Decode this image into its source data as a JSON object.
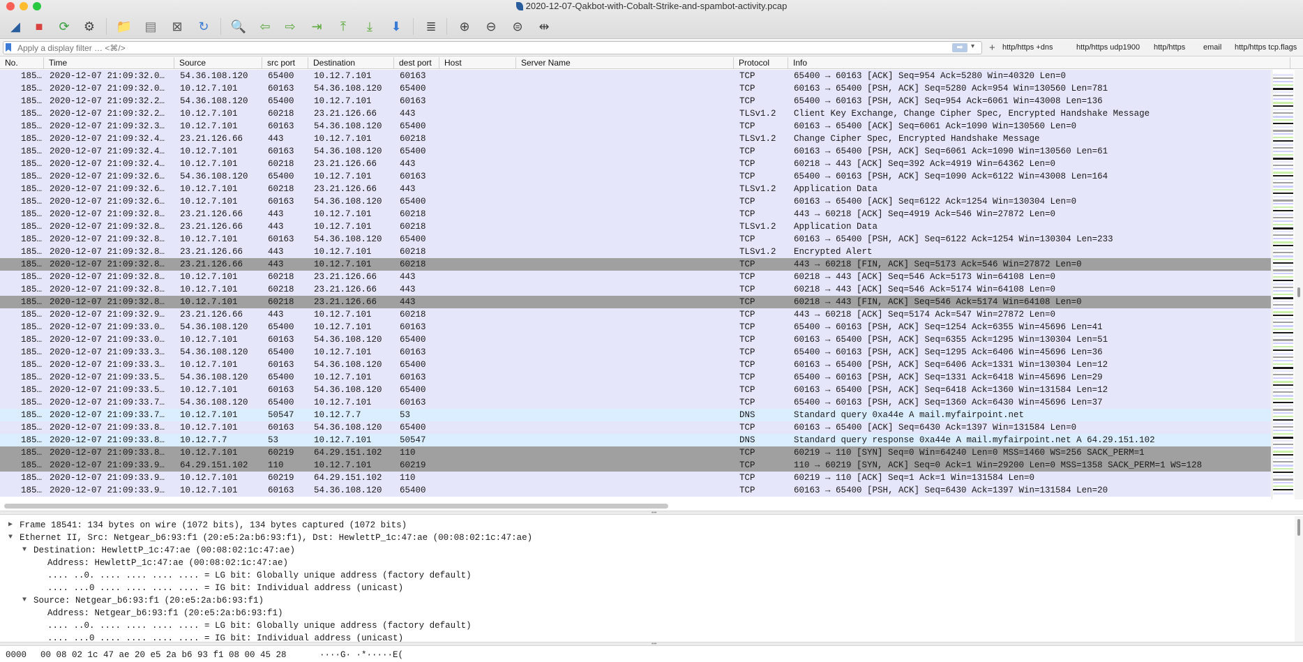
{
  "window": {
    "title": "2020-12-07-Qakbot-with-Cobalt-Strike-and-spambot-activity.pcap",
    "traffic_colors": [
      "#fe5f57",
      "#febc2e",
      "#28c840"
    ]
  },
  "toolbar": [
    {
      "name": "start-capture-icon",
      "glyph": "◢",
      "color": "#2a5d9e"
    },
    {
      "name": "stop-capture-icon",
      "glyph": "■",
      "color": "#d94040"
    },
    {
      "name": "restart-capture-icon",
      "glyph": "⟳",
      "color": "#3aa040"
    },
    {
      "name": "capture-options-icon",
      "glyph": "⚙",
      "color": "#444444"
    },
    {
      "name": "open-file-icon",
      "glyph": "📁",
      "color": "#3a7bd5"
    },
    {
      "name": "save-file-icon",
      "glyph": "▤",
      "color": "#777777"
    },
    {
      "name": "close-file-icon",
      "glyph": "⊠",
      "color": "#555555"
    },
    {
      "name": "reload-file-icon",
      "glyph": "↻",
      "color": "#3a7bd5"
    },
    {
      "name": "find-packet-icon",
      "glyph": "🔍",
      "color": "#444444"
    },
    {
      "name": "go-back-icon",
      "glyph": "⇦",
      "color": "#5aa83a"
    },
    {
      "name": "go-forward-icon",
      "glyph": "⇨",
      "color": "#5aa83a"
    },
    {
      "name": "go-to-packet-icon",
      "glyph": "⇥",
      "color": "#5aa83a"
    },
    {
      "name": "first-packet-icon",
      "glyph": "⤒",
      "color": "#5aa83a"
    },
    {
      "name": "last-packet-icon",
      "glyph": "⤓",
      "color": "#5aa83a"
    },
    {
      "name": "auto-scroll-icon",
      "glyph": "⬇",
      "color": "#3a7bd5"
    },
    {
      "name": "colorize-icon",
      "glyph": "≣",
      "color": "#444444"
    },
    {
      "name": "zoom-in-icon",
      "glyph": "⊕",
      "color": "#444444"
    },
    {
      "name": "zoom-out-icon",
      "glyph": "⊖",
      "color": "#444444"
    },
    {
      "name": "zoom-reset-icon",
      "glyph": "⊜",
      "color": "#444444"
    },
    {
      "name": "resize-columns-icon",
      "glyph": "⇹",
      "color": "#444444"
    }
  ],
  "filter": {
    "placeholder": "Apply a display filter … <⌘/>",
    "buttons": [
      "http/https +dns",
      "http/https udp1900",
      "http/https",
      "email",
      "http/https tcp.flags"
    ]
  },
  "columns": [
    "No.",
    "Time",
    "Source",
    "src port",
    "Destination",
    "dest port",
    "Host",
    "Server Name",
    "Protocol",
    "Info"
  ],
  "packets": [
    {
      "no": "185…",
      "time": "2020-12-07 21:09:32.0…",
      "src": "54.36.108.120",
      "sport": "65400",
      "dst": "10.12.7.101",
      "dport": "60163",
      "host": "",
      "server": "",
      "proto": "TCP",
      "info": "65400 → 60163 [ACK] Seq=954 Ack=5280 Win=40320 Len=0",
      "style": "tcp"
    },
    {
      "no": "185…",
      "time": "2020-12-07 21:09:32.0…",
      "src": "10.12.7.101",
      "sport": "60163",
      "dst": "54.36.108.120",
      "dport": "65400",
      "host": "",
      "server": "",
      "proto": "TCP",
      "info": "60163 → 65400 [PSH, ACK] Seq=5280 Ack=954 Win=130560 Len=781",
      "style": "tcp"
    },
    {
      "no": "185…",
      "time": "2020-12-07 21:09:32.2…",
      "src": "54.36.108.120",
      "sport": "65400",
      "dst": "10.12.7.101",
      "dport": "60163",
      "host": "",
      "server": "",
      "proto": "TCP",
      "info": "65400 → 60163 [PSH, ACK] Seq=954 Ack=6061 Win=43008 Len=136",
      "style": "tcp"
    },
    {
      "no": "185…",
      "time": "2020-12-07 21:09:32.2…",
      "src": "10.12.7.101",
      "sport": "60218",
      "dst": "23.21.126.66",
      "dport": "443",
      "host": "",
      "server": "",
      "proto": "TLSv1.2",
      "info": "Client Key Exchange, Change Cipher Spec, Encrypted Handshake Message",
      "style": "tcp"
    },
    {
      "no": "185…",
      "time": "2020-12-07 21:09:32.3…",
      "src": "10.12.7.101",
      "sport": "60163",
      "dst": "54.36.108.120",
      "dport": "65400",
      "host": "",
      "server": "",
      "proto": "TCP",
      "info": "60163 → 65400 [ACK] Seq=6061 Ack=1090 Win=130560 Len=0",
      "style": "tcp"
    },
    {
      "no": "185…",
      "time": "2020-12-07 21:09:32.4…",
      "src": "23.21.126.66",
      "sport": "443",
      "dst": "10.12.7.101",
      "dport": "60218",
      "host": "",
      "server": "",
      "proto": "TLSv1.2",
      "info": "Change Cipher Spec, Encrypted Handshake Message",
      "style": "tcp"
    },
    {
      "no": "185…",
      "time": "2020-12-07 21:09:32.4…",
      "src": "10.12.7.101",
      "sport": "60163",
      "dst": "54.36.108.120",
      "dport": "65400",
      "host": "",
      "server": "",
      "proto": "TCP",
      "info": "60163 → 65400 [PSH, ACK] Seq=6061 Ack=1090 Win=130560 Len=61",
      "style": "tcp"
    },
    {
      "no": "185…",
      "time": "2020-12-07 21:09:32.4…",
      "src": "10.12.7.101",
      "sport": "60218",
      "dst": "23.21.126.66",
      "dport": "443",
      "host": "",
      "server": "",
      "proto": "TCP",
      "info": "60218 → 443 [ACK] Seq=392 Ack=4919 Win=64362 Len=0",
      "style": "tcp"
    },
    {
      "no": "185…",
      "time": "2020-12-07 21:09:32.6…",
      "src": "54.36.108.120",
      "sport": "65400",
      "dst": "10.12.7.101",
      "dport": "60163",
      "host": "",
      "server": "",
      "proto": "TCP",
      "info": "65400 → 60163 [PSH, ACK] Seq=1090 Ack=6122 Win=43008 Len=164",
      "style": "tcp"
    },
    {
      "no": "185…",
      "time": "2020-12-07 21:09:32.6…",
      "src": "10.12.7.101",
      "sport": "60218",
      "dst": "23.21.126.66",
      "dport": "443",
      "host": "",
      "server": "",
      "proto": "TLSv1.2",
      "info": "Application Data",
      "style": "tcp"
    },
    {
      "no": "185…",
      "time": "2020-12-07 21:09:32.6…",
      "src": "10.12.7.101",
      "sport": "60163",
      "dst": "54.36.108.120",
      "dport": "65400",
      "host": "",
      "server": "",
      "proto": "TCP",
      "info": "60163 → 65400 [ACK] Seq=6122 Ack=1254 Win=130304 Len=0",
      "style": "tcp"
    },
    {
      "no": "185…",
      "time": "2020-12-07 21:09:32.8…",
      "src": "23.21.126.66",
      "sport": "443",
      "dst": "10.12.7.101",
      "dport": "60218",
      "host": "",
      "server": "",
      "proto": "TCP",
      "info": "443 → 60218 [ACK] Seq=4919 Ack=546 Win=27872 Len=0",
      "style": "tcp"
    },
    {
      "no": "185…",
      "time": "2020-12-07 21:09:32.8…",
      "src": "23.21.126.66",
      "sport": "443",
      "dst": "10.12.7.101",
      "dport": "60218",
      "host": "",
      "server": "",
      "proto": "TLSv1.2",
      "info": "Application Data",
      "style": "tcp"
    },
    {
      "no": "185…",
      "time": "2020-12-07 21:09:32.8…",
      "src": "10.12.7.101",
      "sport": "60163",
      "dst": "54.36.108.120",
      "dport": "65400",
      "host": "",
      "server": "",
      "proto": "TCP",
      "info": "60163 → 65400 [PSH, ACK] Seq=6122 Ack=1254 Win=130304 Len=233",
      "style": "tcp"
    },
    {
      "no": "185…",
      "time": "2020-12-07 21:09:32.8…",
      "src": "23.21.126.66",
      "sport": "443",
      "dst": "10.12.7.101",
      "dport": "60218",
      "host": "",
      "server": "",
      "proto": "TLSv1.2",
      "info": "Encrypted Alert",
      "style": "tcp"
    },
    {
      "no": "185…",
      "time": "2020-12-07 21:09:32.8…",
      "src": "23.21.126.66",
      "sport": "443",
      "dst": "10.12.7.101",
      "dport": "60218",
      "host": "",
      "server": "",
      "proto": "TCP",
      "info": "443 → 60218 [FIN, ACK] Seq=5173 Ack=546 Win=27872 Len=0",
      "style": "gray"
    },
    {
      "no": "185…",
      "time": "2020-12-07 21:09:32.8…",
      "src": "10.12.7.101",
      "sport": "60218",
      "dst": "23.21.126.66",
      "dport": "443",
      "host": "",
      "server": "",
      "proto": "TCP",
      "info": "60218 → 443 [ACK] Seq=546 Ack=5173 Win=64108 Len=0",
      "style": "tcp"
    },
    {
      "no": "185…",
      "time": "2020-12-07 21:09:32.8…",
      "src": "10.12.7.101",
      "sport": "60218",
      "dst": "23.21.126.66",
      "dport": "443",
      "host": "",
      "server": "",
      "proto": "TCP",
      "info": "60218 → 443 [ACK] Seq=546 Ack=5174 Win=64108 Len=0",
      "style": "tcp"
    },
    {
      "no": "185…",
      "time": "2020-12-07 21:09:32.8…",
      "src": "10.12.7.101",
      "sport": "60218",
      "dst": "23.21.126.66",
      "dport": "443",
      "host": "",
      "server": "",
      "proto": "TCP",
      "info": "60218 → 443 [FIN, ACK] Seq=546 Ack=5174 Win=64108 Len=0",
      "style": "gray"
    },
    {
      "no": "185…",
      "time": "2020-12-07 21:09:32.9…",
      "src": "23.21.126.66",
      "sport": "443",
      "dst": "10.12.7.101",
      "dport": "60218",
      "host": "",
      "server": "",
      "proto": "TCP",
      "info": "443 → 60218 [ACK] Seq=5174 Ack=547 Win=27872 Len=0",
      "style": "tcp"
    },
    {
      "no": "185…",
      "time": "2020-12-07 21:09:33.0…",
      "src": "54.36.108.120",
      "sport": "65400",
      "dst": "10.12.7.101",
      "dport": "60163",
      "host": "",
      "server": "",
      "proto": "TCP",
      "info": "65400 → 60163 [PSH, ACK] Seq=1254 Ack=6355 Win=45696 Len=41",
      "style": "tcp"
    },
    {
      "no": "185…",
      "time": "2020-12-07 21:09:33.0…",
      "src": "10.12.7.101",
      "sport": "60163",
      "dst": "54.36.108.120",
      "dport": "65400",
      "host": "",
      "server": "",
      "proto": "TCP",
      "info": "60163 → 65400 [PSH, ACK] Seq=6355 Ack=1295 Win=130304 Len=51",
      "style": "tcp"
    },
    {
      "no": "185…",
      "time": "2020-12-07 21:09:33.3…",
      "src": "54.36.108.120",
      "sport": "65400",
      "dst": "10.12.7.101",
      "dport": "60163",
      "host": "",
      "server": "",
      "proto": "TCP",
      "info": "65400 → 60163 [PSH, ACK] Seq=1295 Ack=6406 Win=45696 Len=36",
      "style": "tcp"
    },
    {
      "no": "185…",
      "time": "2020-12-07 21:09:33.3…",
      "src": "10.12.7.101",
      "sport": "60163",
      "dst": "54.36.108.120",
      "dport": "65400",
      "host": "",
      "server": "",
      "proto": "TCP",
      "info": "60163 → 65400 [PSH, ACK] Seq=6406 Ack=1331 Win=130304 Len=12",
      "style": "tcp"
    },
    {
      "no": "185…",
      "time": "2020-12-07 21:09:33.5…",
      "src": "54.36.108.120",
      "sport": "65400",
      "dst": "10.12.7.101",
      "dport": "60163",
      "host": "",
      "server": "",
      "proto": "TCP",
      "info": "65400 → 60163 [PSH, ACK] Seq=1331 Ack=6418 Win=45696 Len=29",
      "style": "tcp"
    },
    {
      "no": "185…",
      "time": "2020-12-07 21:09:33.5…",
      "src": "10.12.7.101",
      "sport": "60163",
      "dst": "54.36.108.120",
      "dport": "65400",
      "host": "",
      "server": "",
      "proto": "TCP",
      "info": "60163 → 65400 [PSH, ACK] Seq=6418 Ack=1360 Win=131584 Len=12",
      "style": "tcp"
    },
    {
      "no": "185…",
      "time": "2020-12-07 21:09:33.7…",
      "src": "54.36.108.120",
      "sport": "65400",
      "dst": "10.12.7.101",
      "dport": "60163",
      "host": "",
      "server": "",
      "proto": "TCP",
      "info": "65400 → 60163 [PSH, ACK] Seq=1360 Ack=6430 Win=45696 Len=37",
      "style": "tcp"
    },
    {
      "no": "185…",
      "time": "2020-12-07 21:09:33.7…",
      "src": "10.12.7.101",
      "sport": "50547",
      "dst": "10.12.7.7",
      "dport": "53",
      "host": "",
      "server": "",
      "proto": "DNS",
      "info": "Standard query 0xa44e A mail.myfairpoint.net",
      "style": "dns"
    },
    {
      "no": "185…",
      "time": "2020-12-07 21:09:33.8…",
      "src": "10.12.7.101",
      "sport": "60163",
      "dst": "54.36.108.120",
      "dport": "65400",
      "host": "",
      "server": "",
      "proto": "TCP",
      "info": "60163 → 65400 [ACK] Seq=6430 Ack=1397 Win=131584 Len=0",
      "style": "tcp"
    },
    {
      "no": "185…",
      "time": "2020-12-07 21:09:33.8…",
      "src": "10.12.7.7",
      "sport": "53",
      "dst": "10.12.7.101",
      "dport": "50547",
      "host": "",
      "server": "",
      "proto": "DNS",
      "info": "Standard query response 0xa44e A mail.myfairpoint.net A 64.29.151.102",
      "style": "dns"
    },
    {
      "no": "185…",
      "time": "2020-12-07 21:09:33.8…",
      "src": "10.12.7.101",
      "sport": "60219",
      "dst": "64.29.151.102",
      "dport": "110",
      "host": "",
      "server": "",
      "proto": "TCP",
      "info": "60219 → 110 [SYN] Seq=0 Win=64240 Len=0 MSS=1460 WS=256 SACK_PERM=1",
      "style": "gray"
    },
    {
      "no": "185…",
      "time": "2020-12-07 21:09:33.9…",
      "src": "64.29.151.102",
      "sport": "110",
      "dst": "10.12.7.101",
      "dport": "60219",
      "host": "",
      "server": "",
      "proto": "TCP",
      "info": "110 → 60219 [SYN, ACK] Seq=0 Ack=1 Win=29200 Len=0 MSS=1358 SACK_PERM=1 WS=128",
      "style": "gray"
    },
    {
      "no": "185…",
      "time": "2020-12-07 21:09:33.9…",
      "src": "10.12.7.101",
      "sport": "60219",
      "dst": "64.29.151.102",
      "dport": "110",
      "host": "",
      "server": "",
      "proto": "TCP",
      "info": "60219 → 110 [ACK] Seq=1 Ack=1 Win=131584 Len=0",
      "style": "tcp"
    },
    {
      "no": "185…",
      "time": "2020-12-07 21:09:33.9…",
      "src": "10.12.7.101",
      "sport": "60163",
      "dst": "54.36.108.120",
      "dport": "65400",
      "host": "",
      "server": "",
      "proto": "TCP",
      "info": "60163 → 65400 [PSH, ACK] Seq=6430 Ack=1397 Win=131584 Len=20",
      "style": "tcp"
    }
  ],
  "details": [
    {
      "indent": 0,
      "caret": "▶",
      "text": "Frame 18541: 134 bytes on wire (1072 bits), 134 bytes captured (1072 bits)"
    },
    {
      "indent": 0,
      "caret": "▼",
      "text": "Ethernet II, Src: Netgear_b6:93:f1 (20:e5:2a:b6:93:f1), Dst: HewlettP_1c:47:ae (00:08:02:1c:47:ae)"
    },
    {
      "indent": 1,
      "caret": "▼",
      "text": "Destination: HewlettP_1c:47:ae (00:08:02:1c:47:ae)"
    },
    {
      "indent": 2,
      "caret": "",
      "text": "Address: HewlettP_1c:47:ae (00:08:02:1c:47:ae)"
    },
    {
      "indent": 2,
      "caret": "",
      "text": ".... ..0. .... .... .... .... = LG bit: Globally unique address (factory default)"
    },
    {
      "indent": 2,
      "caret": "",
      "text": ".... ...0 .... .... .... .... = IG bit: Individual address (unicast)"
    },
    {
      "indent": 1,
      "caret": "▼",
      "text": "Source: Netgear_b6:93:f1 (20:e5:2a:b6:93:f1)"
    },
    {
      "indent": 2,
      "caret": "",
      "text": "Address: Netgear_b6:93:f1 (20:e5:2a:b6:93:f1)"
    },
    {
      "indent": 2,
      "caret": "",
      "text": ".... ..0. .... .... .... .... = LG bit: Globally unique address (factory default)"
    },
    {
      "indent": 2,
      "caret": "",
      "text": ".... ...0 .... .... .... .... = IG bit: Individual address (unicast)"
    }
  ],
  "bytes": [
    {
      "offset": "0000",
      "hex": "00 08 02 1c 47 ae 20 e5  2a b6 93 f1 08 00 45 28",
      "ascii": "····G· ·*·····E("
    }
  ],
  "colors": {
    "tcp_row": "#e6e6fa",
    "dns_row": "#daeeff",
    "highlight_row": "#a0a0a0"
  }
}
